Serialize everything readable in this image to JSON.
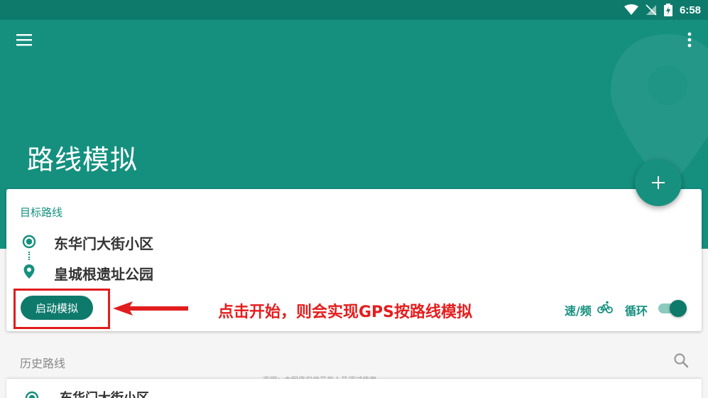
{
  "status_bar": {
    "time": "6:58",
    "icons": [
      "wifi-icon",
      "no-signal-icon",
      "battery-charging-icon"
    ]
  },
  "app_bar": {
    "title": "路线模拟",
    "menu_icon": "menu-icon",
    "more_icon": "more-vertical-icon"
  },
  "fab": {
    "icon": "plus-icon"
  },
  "route_card": {
    "title": "目标路线",
    "start_location": "东华门大街小区",
    "end_location": "皇城根遗址公园",
    "start_button": "启动模拟",
    "speed_label": "速/频",
    "speed_icon": "bicycle-icon",
    "loop_label": "循环",
    "loop_enabled": true
  },
  "annotation": {
    "text": "点击开始，则会实现GPS按路线模拟",
    "color": "#e51d1d"
  },
  "history": {
    "title": "历史路线",
    "disclaimer": "声明：本程序仅供开发人员调试使用",
    "items": [
      {
        "name": "东华门大街小区"
      }
    ]
  },
  "colors": {
    "primary": "#15907f",
    "primary_dark": "#0e7a6c",
    "switch_track": "#8cc9bf",
    "highlight": "#e11d1d"
  }
}
